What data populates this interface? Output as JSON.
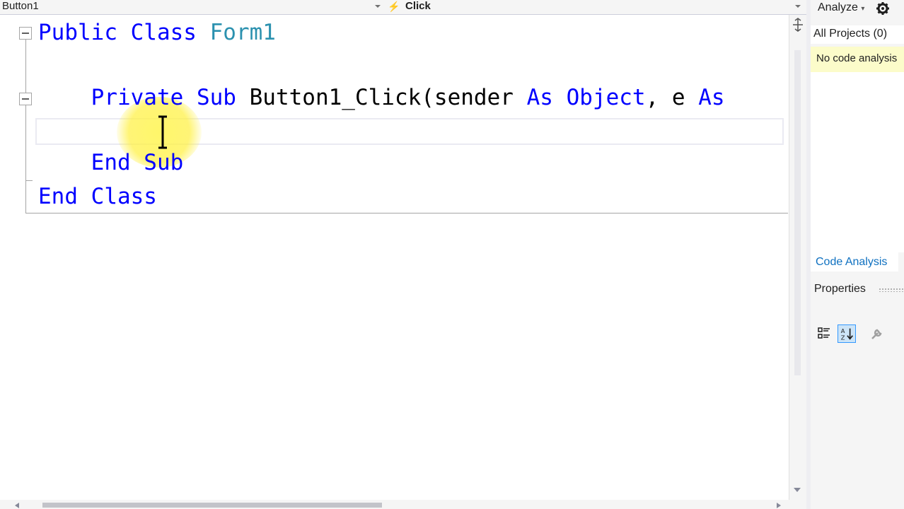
{
  "toolbar": {
    "object_dropdown": "Button1",
    "event_dropdown": "Click"
  },
  "code_lines": {
    "line1_kw": "Public Class",
    "line1_name": "Form1",
    "line3_indent": "    ",
    "line3_kw1": "Private Sub",
    "line3_name": "Button1_Click(sender",
    "line3_kw2": "As",
    "line3_type": "Object",
    "line3_rest": ", e",
    "line3_kw3": "As",
    "line5_kw": "End Sub",
    "line6_kw": "End Class"
  },
  "right_panel": {
    "analyze_label": "Analyze",
    "all_projects": "All Projects (0)",
    "info_message": "No code analysis",
    "code_analysis_tab": "Code Analysis",
    "properties_title": "Properties"
  },
  "colors": {
    "keyword": "#0000ff",
    "type": "#2b91af",
    "link": "#0e70c0",
    "info_bar": "#fcfcca"
  }
}
